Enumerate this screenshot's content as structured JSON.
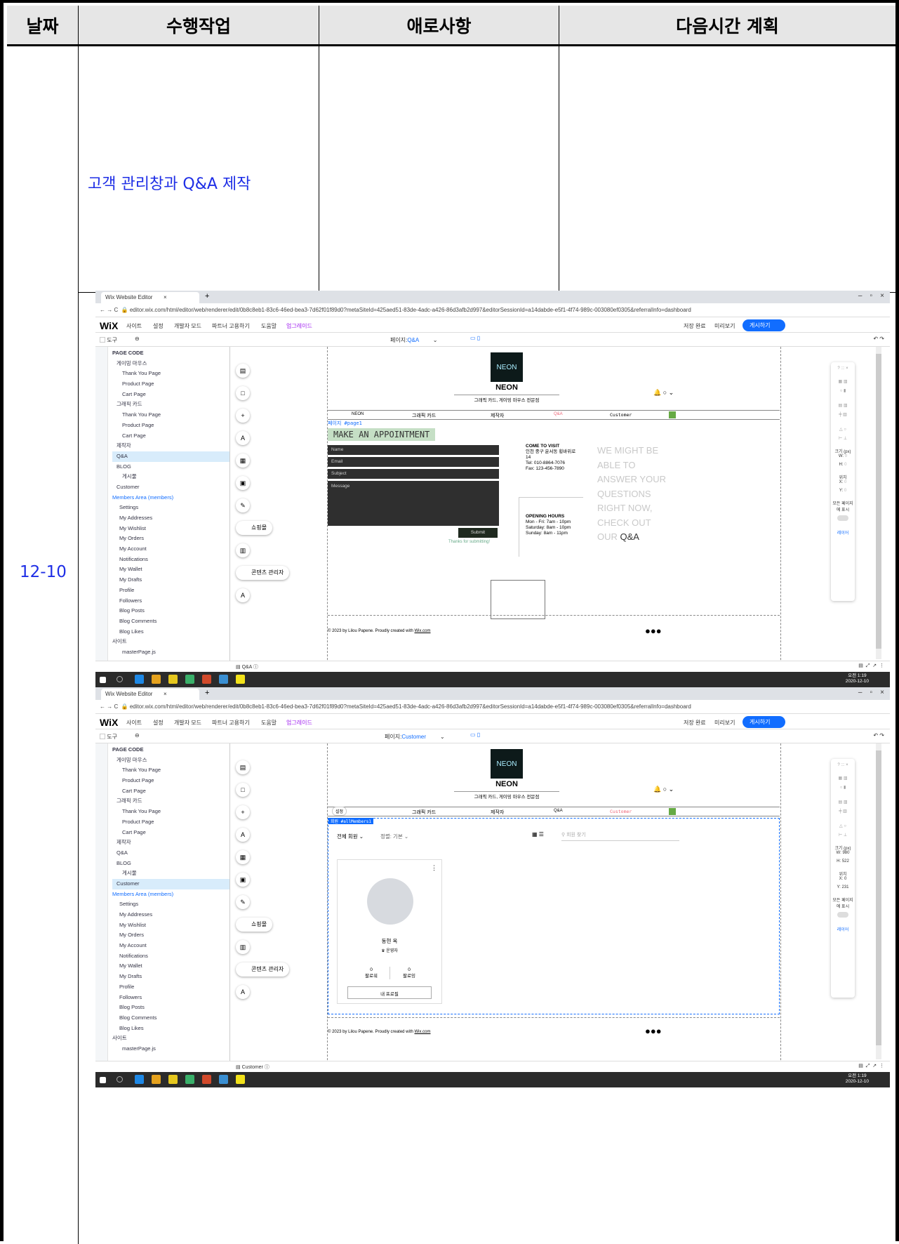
{
  "table": {
    "headers": {
      "date": "날짜",
      "task": "수행작업",
      "difficulty": "애로사항",
      "next": "다음시간 계획"
    },
    "row": {
      "date": "12-10",
      "task": "고객 관리창과 Q&A 제작",
      "difficulty": "",
      "next": ""
    }
  },
  "screenshots": [
    {
      "tab_title": "Wix Website Editor",
      "url": "editor.wix.com/html/editor/web/renderer/edit/0b8c8eb1-83c6-46ed-bea3-7d62f01f89d0?metaSiteId=425aed51-83de-4adc-a426-86d3afb2d997&editorSessionId=a14dabde-e5f1-4f74-989c-003080ef0305&referralInfo=dashboard",
      "wix_menu": [
        "사이트",
        "설정",
        "개발자 모드",
        "파트너 고용하기",
        "도움말",
        "업그레이드"
      ],
      "save_status": "저장 완료",
      "preview": "미리보기",
      "publish": "게시하기",
      "tool_label": "도구",
      "page_label": "페이지:",
      "page_name": "Q&A",
      "left_title": "PAGE CODE",
      "left_items": [
        "게이밍 마우스",
        "Thank You Page",
        "Product Page",
        "Cart Page",
        "그래픽 카드",
        "Thank You Page",
        "Product Page",
        "Cart Page",
        "제작자",
        "Q&A",
        "BLOG",
        "게시물",
        "Customer"
      ],
      "members_header": "Members Area (members)",
      "member_items": [
        "Settings",
        "My Addresses",
        "My Wishlist",
        "My Orders",
        "My Account",
        "Notifications",
        "My Wallet",
        "My Drafts",
        "Profile",
        "Followers",
        "Blog Posts",
        "Blog Comments",
        "Blog Likes"
      ],
      "site_header": "사이트",
      "master_file": "masterPage.js",
      "tool_pills": [
        "쇼핑몰",
        "콘텐츠 관리자"
      ],
      "site_logo": "NEON",
      "site_name": "NEON",
      "site_tagline": "그래픽 카드, 게이밍 마우스 전문점",
      "site_nav": [
        "NEON",
        "그래픽 카드",
        "제작자",
        "Q&A",
        "Customer"
      ],
      "page_tag": "페이지",
      "page_id": "#page1",
      "heading": "MAKE AN APPOINTMENT",
      "form_fields": [
        "Name",
        "Email",
        "Subject",
        "Message"
      ],
      "submit": "Submit",
      "thanks": "Thanks for submitting!",
      "visit_title": "COME TO VISIT",
      "visit_lines": [
        "인천 중구 운서동 횡바위로",
        "14",
        "Tel: 010-8864-7076",
        "Fax: 123-456-7890"
      ],
      "hours_title": "OPENING HOURS",
      "hours_lines": [
        "Mon - Fri: 7am - 10pm",
        "Saturday: 8am - 10pm",
        "Sunday: 8am - 11pm"
      ],
      "big_text": [
        "WE MIGHT BE",
        "ABLE TO",
        "ANSWER YOUR",
        "QUESTIONS",
        "RIGHT NOW,",
        "CHECK OUT",
        "OUR"
      ],
      "big_text_end": "Q&A",
      "footer": "© 2023 by Lilou Papene. Proudly created with",
      "footer_link": "Wix.com",
      "bottom_tab": "Q&A",
      "clock": {
        "time": "오전 1:19",
        "date": "2020-12-10"
      },
      "right_panel": {
        "size": "크기 (px)",
        "w": "W:",
        "h": "H:",
        "w_val": "0",
        "h_val": "0",
        "pos": "위치",
        "x": "X:",
        "y": "Y:",
        "x_val": "0",
        "y_val": "0",
        "all_pages": "모든 페이지에 표시",
        "layers": "레이어"
      }
    },
    {
      "tab_title": "Wix Website Editor",
      "url": "editor.wix.com/html/editor/web/renderer/edit/0b8c8eb1-83c6-46ed-bea3-7d62f01f89d0?metaSiteId=425aed51-83de-4adc-a426-86d3afb2d997&editorSessionId=a14dabde-e5f1-4f74-989c-003080ef0305&referralInfo=dashboard",
      "wix_menu": [
        "사이트",
        "설정",
        "개발자 모드",
        "파트너 고용하기",
        "도움말",
        "업그레이드"
      ],
      "save_status": "저장 완료",
      "preview": "미리보기",
      "publish": "게시하기",
      "tool_label": "도구",
      "page_label": "페이지:",
      "page_name": "Customer",
      "left_title": "PAGE CODE",
      "left_items": [
        "게이밍 마우스",
        "Thank You Page",
        "Product Page",
        "Cart Page",
        "그래픽 카드",
        "Thank You Page",
        "Product Page",
        "Cart Page",
        "제작자",
        "Q&A",
        "BLOG",
        "게시물",
        "Customer"
      ],
      "members_header": "Members Area (members)",
      "member_items": [
        "Settings",
        "My Addresses",
        "My Wishlist",
        "My Orders",
        "My Account",
        "Notifications",
        "My Wallet",
        "My Drafts",
        "Profile",
        "Followers",
        "Blog Posts",
        "Blog Comments",
        "Blog Likes"
      ],
      "site_header": "사이트",
      "master_file": "masterPage.js",
      "tool_pills": [
        "쇼핑몰",
        "콘텐츠 관리자"
      ],
      "site_logo": "NEON",
      "site_name": "NEON",
      "site_tagline": "그래픽 카드, 게이밍 마우스 전문점",
      "site_nav": [
        "설정",
        "그래픽 카드",
        "제작자",
        "Q&A",
        "Customer"
      ],
      "element_tag": "회원",
      "element_id": "#allMembers1",
      "filter_all": "전체 회원",
      "sort": "정렬: 기본",
      "search_placeholder": "회원 찾기",
      "member_name": "동현 옥",
      "member_role": "운영자",
      "followers_count": "0",
      "followers_label": "팔로워",
      "following_count": "0",
      "following_label": "팔로잉",
      "profile_button": "내 프로필",
      "footer": "© 2023 by Lilou Papene. Proudly created with",
      "footer_link": "Wix.com",
      "bottom_tab": "Customer",
      "clock": {
        "time": "오전 1:19",
        "date": "2020-12-10"
      },
      "right_panel": {
        "size": "크기 (px)",
        "w": "W:",
        "h": "H:",
        "w_val": "980",
        "h_val": "522",
        "pos": "위치",
        "x": "X:",
        "y": "Y:",
        "x_val": "0",
        "y_val": "231",
        "all_pages": "모든 페이지에 표시",
        "layers": "레이어"
      }
    }
  ],
  "colors": {
    "link_blue": "#1e2ee6",
    "wix_blue": "#116dff",
    "header_gray": "#e6e6e6",
    "form_dark": "#2f2f2f",
    "submit_green": "#1f2a1f",
    "taskbar": "#2b2b2b"
  }
}
